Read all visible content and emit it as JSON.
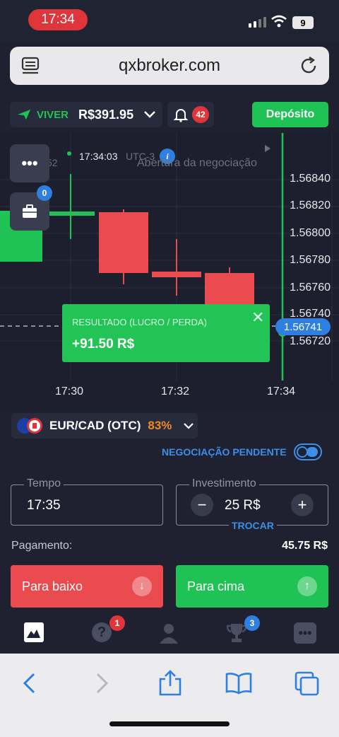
{
  "status": {
    "time": "17:34",
    "battery": "9"
  },
  "browser": {
    "url": "qxbroker.com"
  },
  "header": {
    "live_label": "VIVER",
    "balance": "R$391.95",
    "notifications": "42",
    "deposit_label": "Depósito"
  },
  "chart": {
    "timestamp": "17:34:03",
    "timezone": "UTC-3",
    "open_trade_text": "Abertura da negociação",
    "partial_left": "52",
    "portfolio_count": "0",
    "price_labels": [
      "1.56840",
      "1.56820",
      "1.56800",
      "1.56780",
      "1.56760",
      "1.56740",
      "1.56720"
    ],
    "current_price": "1.56741",
    "x_labels": [
      "17:30",
      "17:32",
      "17:34"
    ],
    "result_title": "RESULTADO (LUCRO / PERDA)",
    "result_value": "+91.50 R$"
  },
  "colors": {
    "up": "#1fc254",
    "down": "#e94b4e",
    "accent": "#3d8ee8"
  },
  "pair": {
    "name": "EUR/CAD (OTC)",
    "payout": "83%"
  },
  "pending_label": "NEGOCIAÇÃO PENDENTE",
  "time_field": {
    "label": "Tempo",
    "value": "17:35"
  },
  "invest_field": {
    "label": "Investimento",
    "value": "25 R$",
    "swap_label": "TROCAR"
  },
  "payout": {
    "label": "Pagamento:",
    "value": "45.75 R$"
  },
  "buttons": {
    "down": "Para baixo",
    "up": "Para cima"
  },
  "tabs": {
    "help_badge": "1",
    "trophy_badge": "3"
  }
}
